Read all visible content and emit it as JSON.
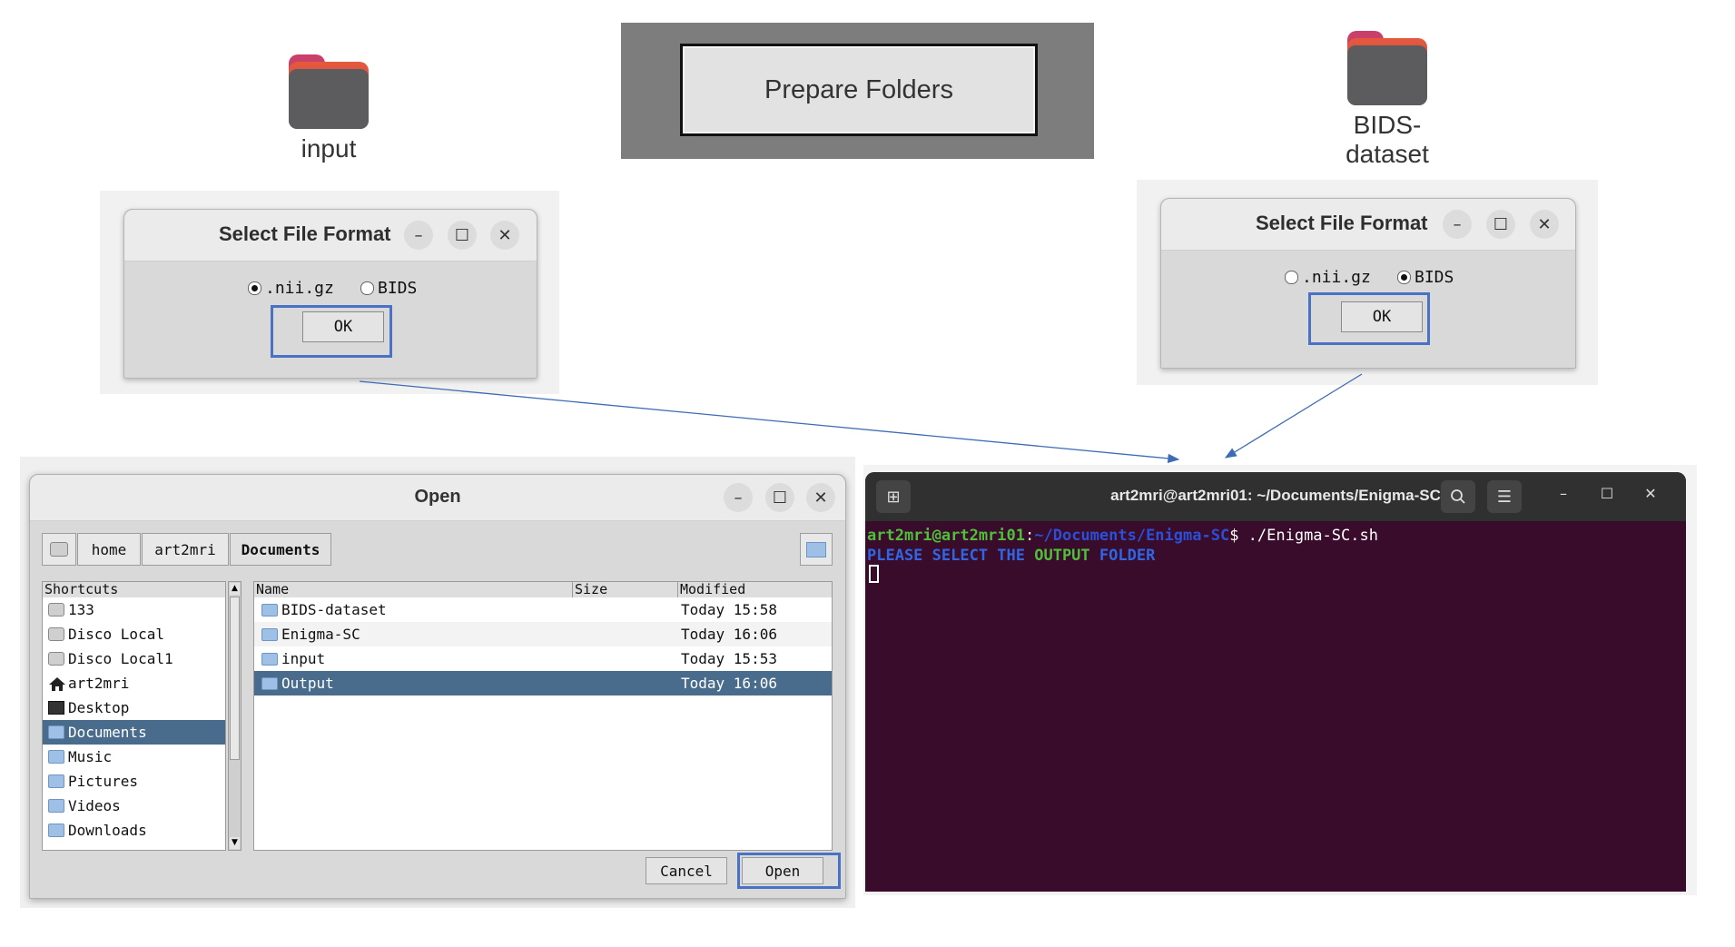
{
  "desktop": {
    "input_folder_label": "input",
    "bids_folder_label_line1": "BIDS-",
    "bids_folder_label_line2": "dataset"
  },
  "prepare": {
    "button_label": "Prepare Folders"
  },
  "format_dialog_left": {
    "title": "Select File Format",
    "minimize": "–",
    "maximize": "☐",
    "close": "✕",
    "option1": ".nii.gz",
    "option2": "BIDS",
    "selected": "option1",
    "ok_label": "OK"
  },
  "format_dialog_right": {
    "title": "Select File Format",
    "minimize": "–",
    "maximize": "☐",
    "close": "✕",
    "option1": ".nii.gz",
    "option2": "BIDS",
    "selected": "option2",
    "ok_label": "OK"
  },
  "open_dialog": {
    "title": "Open",
    "minimize": "–",
    "maximize": "☐",
    "close": "✕",
    "breadcrumbs": [
      "home",
      "art2mri",
      "Documents"
    ],
    "shortcuts_header": "Shortcuts",
    "shortcuts": [
      {
        "label": "133",
        "icon": "drive-icon"
      },
      {
        "label": "Disco Local",
        "icon": "drive-icon"
      },
      {
        "label": "Disco Local1",
        "icon": "drive-icon"
      },
      {
        "label": "art2mri",
        "icon": "home-icon"
      },
      {
        "label": "Desktop",
        "icon": "desktop-icon"
      },
      {
        "label": "Documents",
        "icon": "folder-icon",
        "selected": true
      },
      {
        "label": "Music",
        "icon": "folder-icon"
      },
      {
        "label": "Pictures",
        "icon": "folder-icon"
      },
      {
        "label": "Videos",
        "icon": "folder-icon"
      },
      {
        "label": "Downloads",
        "icon": "folder-icon"
      }
    ],
    "columns": {
      "name": "Name",
      "size": "Size",
      "modified": "Modified"
    },
    "files": [
      {
        "name": "BIDS-dataset",
        "modified": "Today 15:58"
      },
      {
        "name": "Enigma-SC",
        "modified": "Today 16:06"
      },
      {
        "name": "input",
        "modified": "Today 15:53"
      },
      {
        "name": "Output",
        "modified": "Today 16:06",
        "selected": true
      }
    ],
    "cancel_label": "Cancel",
    "open_label": "Open"
  },
  "terminal": {
    "title": "art2mri@art2mri01: ~/Documents/Enigma-SC",
    "prompt_user": "art2mri@art2mri01",
    "prompt_sep": ":",
    "prompt_path": "~/Documents/Enigma-SC",
    "prompt_cmd": "$ ./Enigma-SC.sh",
    "output_part1": "PLEASE SELECT THE ",
    "output_part2": "OUTPUT",
    "output_part3": " FOLDER",
    "colors": {
      "green": "#4ec03a",
      "blue": "#2f66e6",
      "path": "#2b4fd6",
      "bg": "#380c2a"
    }
  },
  "colors": {
    "highlight": "#4a72c4",
    "arrow": "#3d6bb5",
    "selection": "#4a6c8c"
  }
}
